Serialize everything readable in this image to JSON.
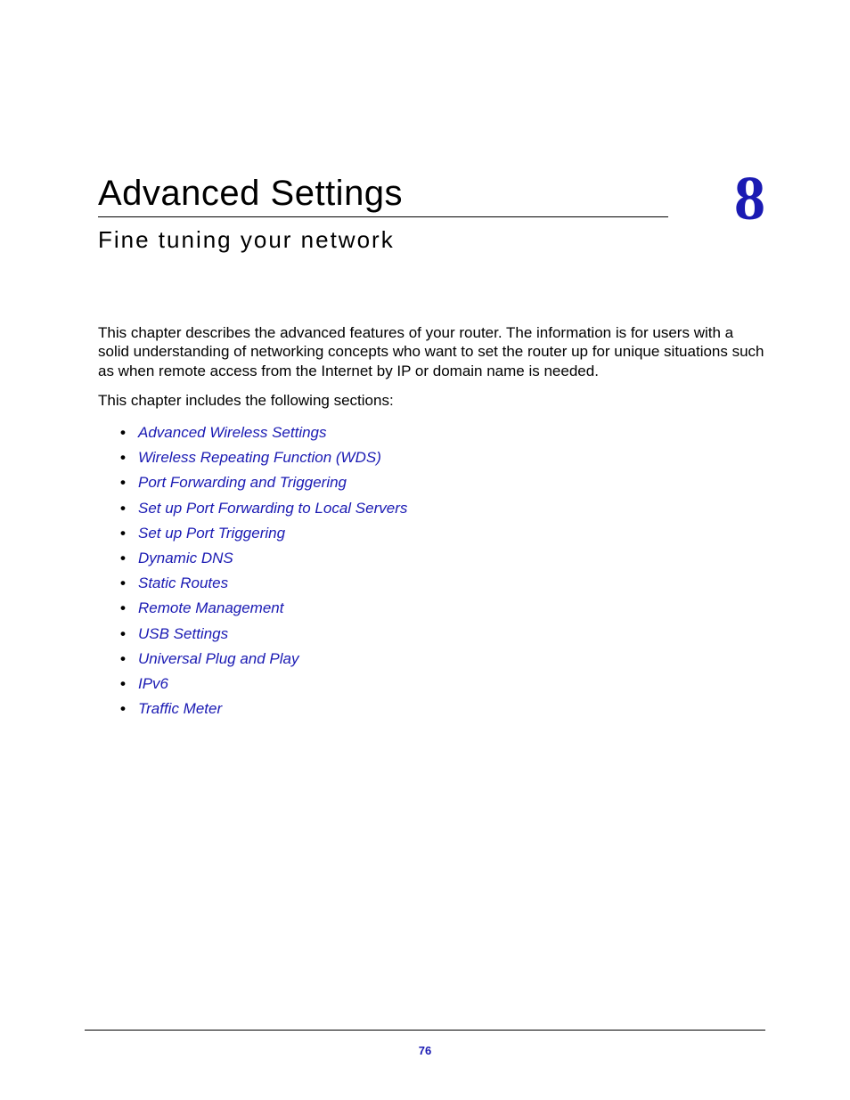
{
  "chapter": {
    "title": "Advanced Settings",
    "number": "8",
    "subtitle": "Fine tuning your network"
  },
  "intro": {
    "p1": "This chapter describes the advanced features of your router. The information is for users with a solid understanding of networking concepts who want to set the router up for unique situations such as when remote access from the Internet by IP or domain name is needed.",
    "p2": "This chapter includes the following sections:"
  },
  "toc": [
    "Advanced Wireless Settings",
    "Wireless Repeating Function (WDS)",
    "Port Forwarding and Triggering",
    "Set up Port Forwarding to Local Servers",
    "Set up Port Triggering",
    "Dynamic DNS",
    "Static Routes",
    "Remote Management",
    "USB Settings",
    "Universal Plug and Play",
    "IPv6",
    "Traffic Meter"
  ],
  "page_number": "76"
}
